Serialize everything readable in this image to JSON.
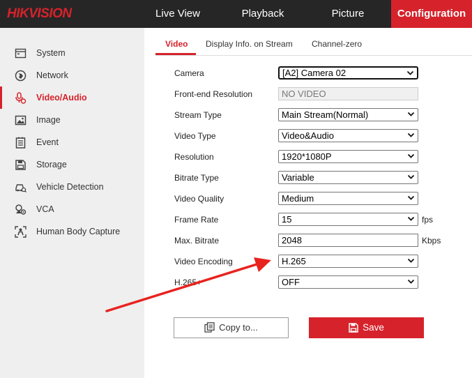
{
  "brand": {
    "logo": "HIKVISION",
    "accent": "#d6222b"
  },
  "topnav": {
    "live_view": "Live View",
    "playback": "Playback",
    "picture": "Picture",
    "configuration": "Configuration",
    "active": "configuration"
  },
  "sidebar": {
    "items": [
      {
        "label": "System",
        "icon": "system-icon"
      },
      {
        "label": "Network",
        "icon": "network-icon"
      },
      {
        "label": "Video/Audio",
        "icon": "video-audio-icon",
        "active": true
      },
      {
        "label": "Image",
        "icon": "image-icon"
      },
      {
        "label": "Event",
        "icon": "event-icon"
      },
      {
        "label": "Storage",
        "icon": "storage-icon"
      },
      {
        "label": "Vehicle Detection",
        "icon": "vehicle-detection-icon"
      },
      {
        "label": "VCA",
        "icon": "vca-icon"
      },
      {
        "label": "Human Body Capture",
        "icon": "human-body-icon"
      }
    ]
  },
  "tabs": {
    "video": "Video",
    "display_info": "Display Info. on Stream",
    "channel_zero": "Channel-zero",
    "active": "video"
  },
  "form": {
    "camera": {
      "label": "Camera",
      "value": "[A2] Camera 02"
    },
    "frontend_resolution": {
      "label": "Front-end Resolution",
      "value": "NO VIDEO"
    },
    "stream_type": {
      "label": "Stream Type",
      "value": "Main Stream(Normal)"
    },
    "video_type": {
      "label": "Video Type",
      "value": "Video&Audio"
    },
    "resolution": {
      "label": "Resolution",
      "value": "1920*1080P"
    },
    "bitrate_type": {
      "label": "Bitrate Type",
      "value": "Variable"
    },
    "video_quality": {
      "label": "Video Quality",
      "value": "Medium"
    },
    "frame_rate": {
      "label": "Frame Rate",
      "value": "15",
      "unit": "fps"
    },
    "max_bitrate": {
      "label": "Max. Bitrate",
      "value": "2048",
      "unit": "Kbps"
    },
    "video_encoding": {
      "label": "Video Encoding",
      "value": "H.265"
    },
    "h265_plus": {
      "label": "H.265+",
      "value": "OFF"
    }
  },
  "buttons": {
    "copy": "Copy to...",
    "save": "Save"
  },
  "annotation": {
    "arrow_color": "#e8231f"
  }
}
